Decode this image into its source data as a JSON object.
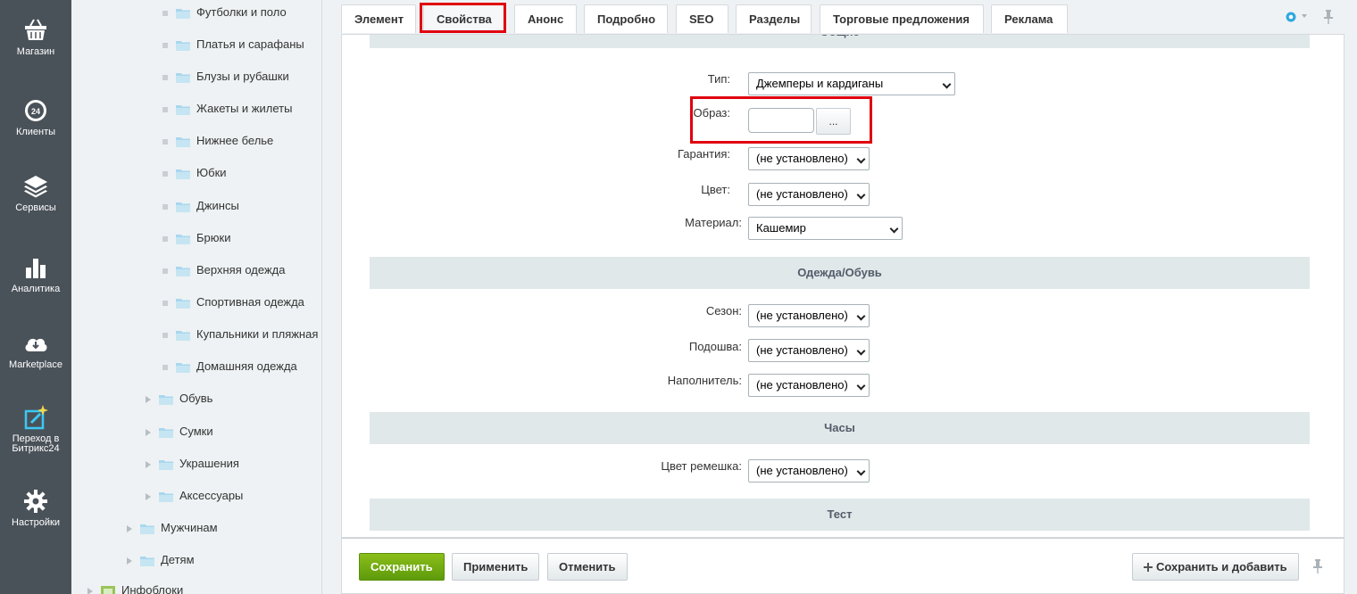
{
  "left_menu": [
    {
      "label": "Магазин",
      "icon": "basket-icon"
    },
    {
      "label": "Клиенты",
      "icon": "crm-24-icon"
    },
    {
      "label": "Сервисы",
      "icon": "layers-icon"
    },
    {
      "label": "Аналитика",
      "icon": "bar-chart-icon"
    },
    {
      "label": "Marketplace",
      "icon": "cloud-download-icon"
    },
    {
      "label1": "Переход в",
      "label2": "Битрикс24",
      "icon": "sparkle-edit-icon"
    },
    {
      "label": "Настройки",
      "icon": "gear-icon"
    }
  ],
  "tree": {
    "sub_items": [
      "Футболки и поло",
      "Платья и сарафаны",
      "Блузы и рубашки",
      "Жакеты и жилеты",
      "Нижнее белье",
      "Юбки",
      "Джинсы",
      "Брюки",
      "Верхняя одежда",
      "Спортивная одежда",
      "Купальники и пляжная",
      "Домашняя одежда"
    ],
    "collapsed_items": [
      "Обувь",
      "Сумки",
      "Украшения",
      "Аксессуары"
    ],
    "top_items": [
      "Мужчинам",
      "Детям"
    ],
    "bottom_item": "Инфоблоки"
  },
  "tabs": [
    "Элемент",
    "Свойства",
    "Анонс",
    "Подробно",
    "SEO",
    "Разделы",
    "Торговые предложения",
    "Реклама"
  ],
  "active_tab": "Свойства",
  "sections": {
    "general_partial": "Общие",
    "clothes": "Одежда/Обувь",
    "watches": "Часы",
    "test": "Тест"
  },
  "fields": {
    "type": {
      "label": "Тип:",
      "value": "Джемперы и кардиганы"
    },
    "image": {
      "label": "Образ:",
      "value": "",
      "button": "..."
    },
    "warranty": {
      "label": "Гарантия:",
      "value": "(не установлено)"
    },
    "color": {
      "label": "Цвет:",
      "value": "(не установлено)"
    },
    "material": {
      "label": "Материал:",
      "value": "Кашемир"
    },
    "season": {
      "label": "Сезон:",
      "value": "(не установлено)"
    },
    "sole": {
      "label": "Подошва:",
      "value": "(не установлено)"
    },
    "filler": {
      "label": "Наполнитель:",
      "value": "(не установлено)"
    },
    "strap_color": {
      "label": "Цвет ремешка:",
      "value": "(не установлено)"
    }
  },
  "buttons": {
    "save": "Сохранить",
    "apply": "Применить",
    "cancel": "Отменить",
    "save_add": "Сохранить и добавить",
    "save_add_icon": "plus-icon"
  },
  "colors": {
    "highlight": "#e0000e",
    "save_green": "#6fa70f",
    "menu_bg": "#4a5259"
  }
}
